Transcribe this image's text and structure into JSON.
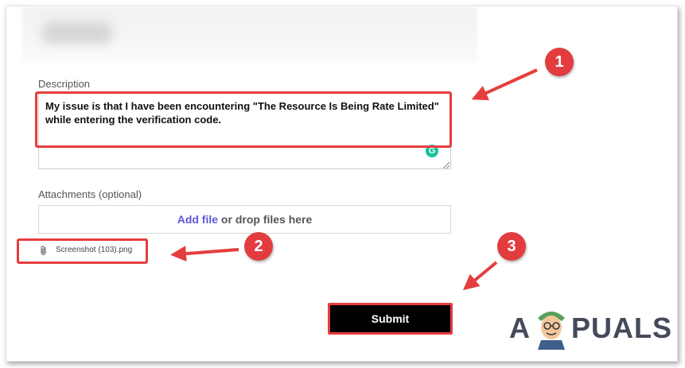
{
  "description": {
    "label": "Description",
    "text": "My issue is that I have been encountering \"The Resource Is Being Rate Limited\" while entering the verification code."
  },
  "attachments": {
    "label": "Attachments (optional)",
    "add_file": "Add file",
    "drop_text": " or drop files here",
    "file_name": "Screenshot (103).png",
    "remove": "×"
  },
  "submit_label": "Submit",
  "grammarly_glyph": "G",
  "steps": [
    "1",
    "2",
    "3"
  ],
  "logo": {
    "left": "A",
    "right": "PUALS"
  },
  "colors": {
    "highlight": "#e53e3e",
    "badge": "#e23c3f",
    "link": "#5b58d6",
    "submit_bg": "#000000",
    "grammarly": "#15c39a"
  },
  "icons": [
    "paperclip-icon",
    "close-icon",
    "grammarly-icon",
    "resize-grip-icon",
    "arrow-icon"
  ]
}
